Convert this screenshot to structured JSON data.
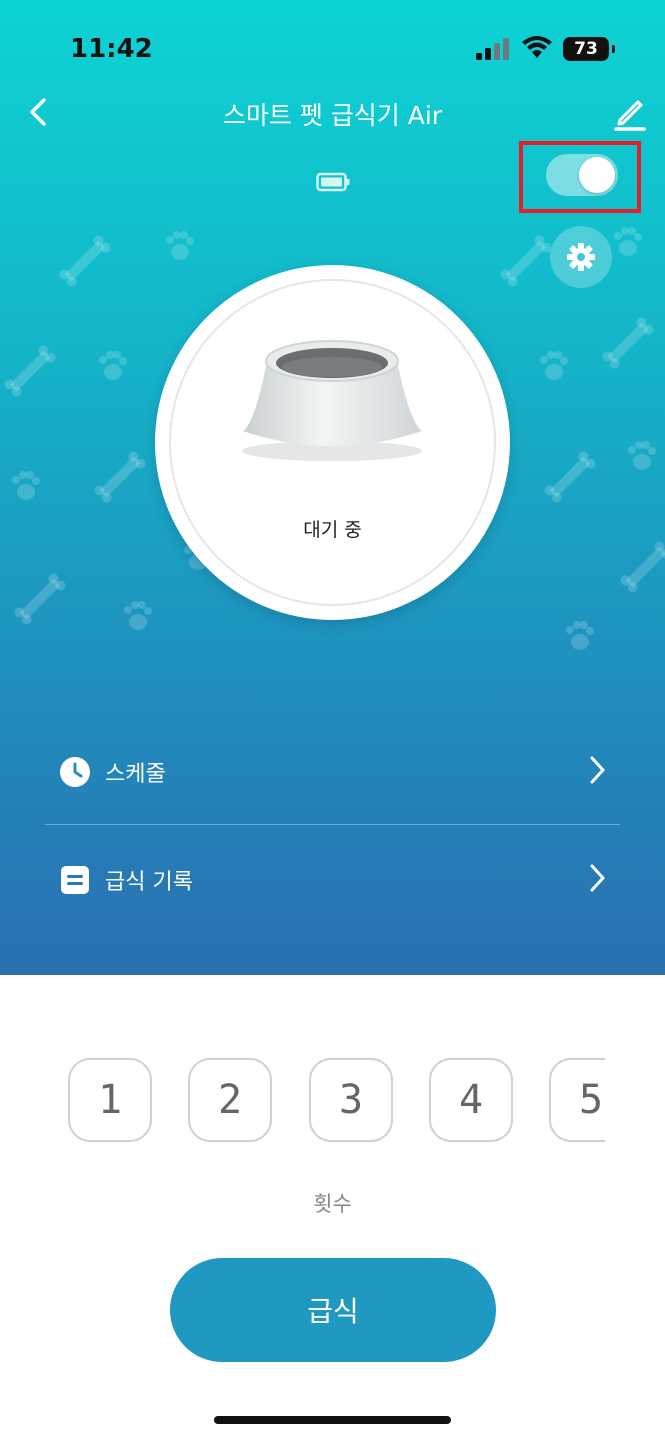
{
  "status_bar": {
    "time": "11:42",
    "battery": "73",
    "signal_icon": "cellular-signal-icon",
    "wifi_icon": "wifi-icon"
  },
  "nav": {
    "title": "스마트 펫 급식기 Air",
    "back_icon": "chevron-left-icon",
    "edit_icon": "pencil-icon"
  },
  "device": {
    "battery_icon": "battery-icon",
    "power_on": true,
    "settings_icon": "gear-icon",
    "status": "대기 중"
  },
  "menu": [
    {
      "label": "스케줄",
      "icon": "clock-icon"
    },
    {
      "label": "급식 기록",
      "icon": "list-icon"
    }
  ],
  "portions": {
    "options": [
      "1",
      "2",
      "3",
      "4",
      "5"
    ],
    "label": "횟수"
  },
  "feed_button": {
    "label": "급식"
  },
  "colors": {
    "gradient_top": "#0dd3d3",
    "gradient_bottom": "#2a6fb0",
    "feed_button": "#1f98c2",
    "highlight_frame": "#e0202b"
  }
}
